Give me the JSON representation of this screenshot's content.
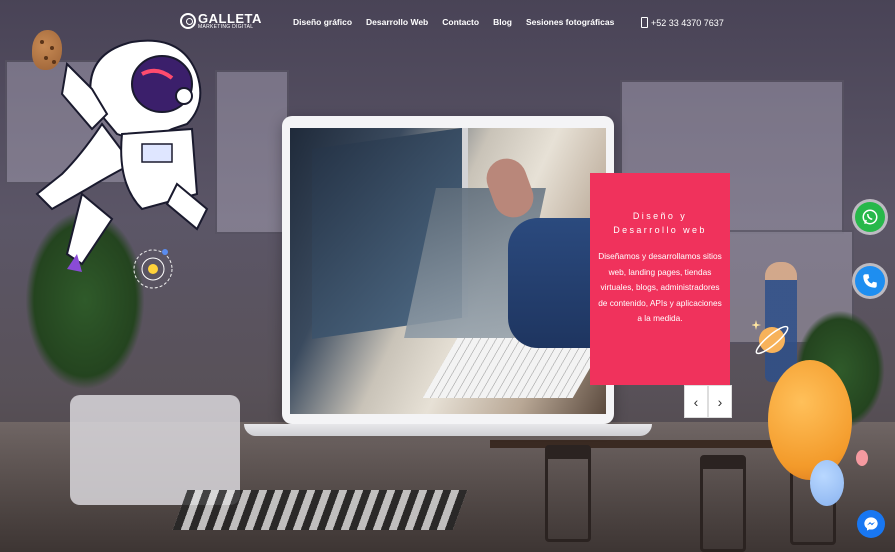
{
  "logo": {
    "title": "GALLETA",
    "subtitle": "MARKETING DIGITAL"
  },
  "nav": [
    {
      "label": "Diseño gráfico"
    },
    {
      "label": "Desarrollo Web"
    },
    {
      "label": "Contacto"
    },
    {
      "label": "Blog"
    },
    {
      "label": "Sesiones fotográficas"
    }
  ],
  "phone": {
    "number": "+52 33 4370 7637",
    "icon": "phone-icon"
  },
  "slide": {
    "title": "Diseño y Desarrollo web",
    "body": "Diseñamos y desarrollamos sitios web, landing pages, tiendas virtuales, blogs, administradores de contenido, APIs y aplicaciones a la medida.",
    "prev_label": "‹",
    "next_label": "›"
  },
  "floating_buttons": [
    {
      "icon": "whatsapp-icon",
      "color": "#27b84a"
    },
    {
      "icon": "phone-icon",
      "color": "#1e8ef0"
    },
    {
      "icon": "messenger-icon",
      "color": "#1877f2"
    }
  ],
  "colors": {
    "accent": "#f0325c"
  }
}
